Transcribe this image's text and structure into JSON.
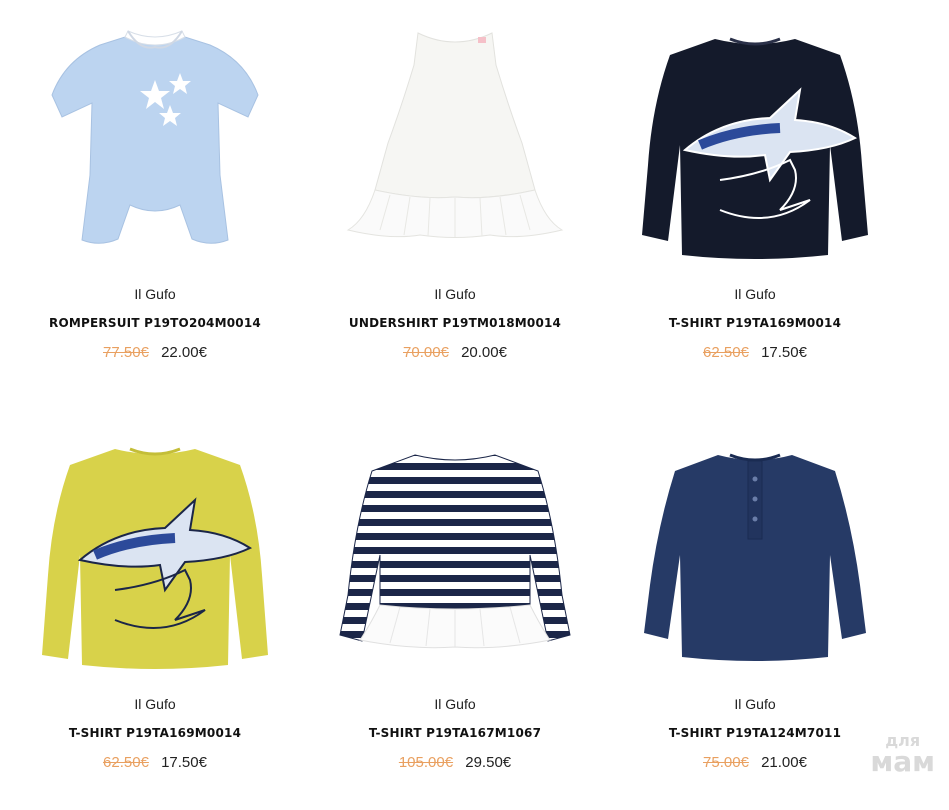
{
  "products": [
    {
      "brand": "Il Gufo",
      "name": "ROMPERSUIT P19TO204M0014",
      "old_price": "77.50€",
      "new_price": "22.00€",
      "image_icon": "romper-icon",
      "color": "#bcd4f0"
    },
    {
      "brand": "Il Gufo",
      "name": "UNDERSHIRT P19TM018M0014",
      "old_price": "70.00€",
      "new_price": "20.00€",
      "image_icon": "tank-dress-icon",
      "color": "#f7f7f5"
    },
    {
      "brand": "Il Gufo",
      "name": "T-SHIRT P19TA169M0014",
      "old_price": "62.50€",
      "new_price": "17.50€",
      "image_icon": "shark-shirt-icon",
      "color": "#141a2b"
    },
    {
      "brand": "Il Gufo",
      "name": "T-SHIRT P19TA169M0014",
      "old_price": "62.50€",
      "new_price": "17.50€",
      "image_icon": "shark-shirt-icon",
      "color": "#d8d24a"
    },
    {
      "brand": "Il Gufo",
      "name": "T-SHIRT P19TA167M1067",
      "old_price": "105.00€",
      "new_price": "29.50€",
      "image_icon": "striped-shirt-icon",
      "color": "#1b2648"
    },
    {
      "brand": "Il Gufo",
      "name": "T-SHIRT P19TA124M7011",
      "old_price": "75.00€",
      "new_price": "21.00€",
      "image_icon": "henley-shirt-icon",
      "color": "#263a66"
    }
  ],
  "watermark": {
    "line1": "для",
    "line2": "мам"
  }
}
